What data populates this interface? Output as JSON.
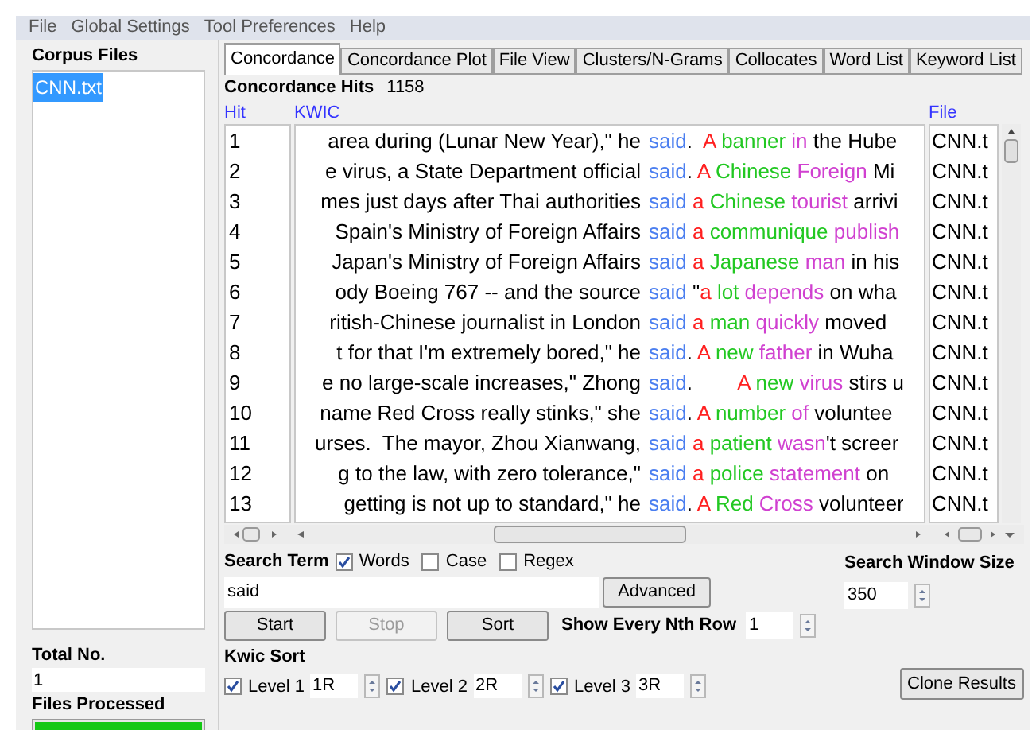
{
  "menu": [
    "File",
    "Global Settings",
    "Tool Preferences",
    "Help"
  ],
  "corpus": {
    "title": "Corpus Files",
    "files": [
      {
        "name": "CNN.txt",
        "selected": true
      }
    ],
    "total_label": "Total No.",
    "total": "1",
    "processed_label": "Files Processed",
    "progress": {
      "level": 1
    }
  },
  "tabs": [
    {
      "label": "Concordance",
      "selected": true
    },
    {
      "label": "Concordance Plot",
      "selected": false
    },
    {
      "label": "File View",
      "selected": false
    },
    {
      "label": "Clusters/N-Grams",
      "selected": false
    },
    {
      "label": "Collocates",
      "selected": false
    },
    {
      "label": "Word List",
      "selected": false
    },
    {
      "label": "Keyword List",
      "selected": false
    }
  ],
  "hits_label": "Concordance Hits",
  "hits": "1158",
  "columns": [
    "Hit",
    "KWIC",
    "File"
  ],
  "rows": [
    {
      "hit": "1",
      "left": "area during (Lunar New Year),\" he",
      "keyword": "said",
      "right": [
        {
          "text": ".  "
        },
        {
          "text": "A ",
          "color": "#ff2020"
        },
        {
          "text": "banner ",
          "color": "#22c822"
        },
        {
          "text": "in ",
          "color": "#d040d0"
        },
        {
          "text": "the Hube"
        }
      ],
      "file": "CNN.t"
    },
    {
      "hit": "2",
      "left": "e virus, a State Department official",
      "keyword": "said",
      "right": [
        {
          "text": ". "
        },
        {
          "text": "A ",
          "color": "#ff2020"
        },
        {
          "text": "Chinese ",
          "color": "#22c822"
        },
        {
          "text": "Foreign ",
          "color": "#d040d0"
        },
        {
          "text": "Mi"
        }
      ],
      "file": "CNN.t"
    },
    {
      "hit": "3",
      "left": "mes just days after Thai authorities",
      "keyword": "said",
      "right": [
        {
          "text": " a ",
          "color": "#ff2020"
        },
        {
          "text": "Chinese ",
          "color": "#22c822"
        },
        {
          "text": "tourist ",
          "color": "#d040d0"
        },
        {
          "text": "arrivi"
        }
      ],
      "file": "CNN.t"
    },
    {
      "hit": "4",
      "left": "Spain's Ministry of Foreign Affairs",
      "keyword": "said",
      "right": [
        {
          "text": " a ",
          "color": "#ff2020"
        },
        {
          "text": "communique ",
          "color": "#22c822"
        },
        {
          "text": "publish",
          "color": "#d040d0"
        }
      ],
      "file": "CNN.t"
    },
    {
      "hit": "5",
      "left": "Japan's Ministry of Foreign Affairs",
      "keyword": "said",
      "right": [
        {
          "text": " a ",
          "color": "#ff2020"
        },
        {
          "text": "Japanese ",
          "color": "#22c822"
        },
        {
          "text": "man ",
          "color": "#d040d0"
        },
        {
          "text": "in his"
        }
      ],
      "file": "CNN.t"
    },
    {
      "hit": "6",
      "left": "ody Boeing 767 -- and the source",
      "keyword": "said",
      "right": [
        {
          "text": " \""
        },
        {
          "text": "a ",
          "color": "#ff2020"
        },
        {
          "text": "lot ",
          "color": "#22c822"
        },
        {
          "text": "depends ",
          "color": "#d040d0"
        },
        {
          "text": "on wha"
        }
      ],
      "file": "CNN.t"
    },
    {
      "hit": "7",
      "left": "ritish-Chinese journalist in London",
      "keyword": "said",
      "right": [
        {
          "text": " a ",
          "color": "#ff2020"
        },
        {
          "text": "man ",
          "color": "#22c822"
        },
        {
          "text": "quickly ",
          "color": "#d040d0"
        },
        {
          "text": "moved"
        }
      ],
      "file": "CNN.t"
    },
    {
      "hit": "8",
      "left": "t for that I'm extremely bored,\" he",
      "keyword": "said",
      "right": [
        {
          "text": ". "
        },
        {
          "text": "A ",
          "color": "#ff2020"
        },
        {
          "text": "new ",
          "color": "#22c822"
        },
        {
          "text": "father ",
          "color": "#d040d0"
        },
        {
          "text": "in Wuha"
        }
      ],
      "file": "CNN.t"
    },
    {
      "hit": "9",
      "left": "e no large-scale increases,\" Zhong",
      "keyword": "said",
      "right": [
        {
          "text": ".        "
        },
        {
          "text": "A ",
          "color": "#ff2020"
        },
        {
          "text": "new ",
          "color": "#22c822"
        },
        {
          "text": "virus ",
          "color": "#d040d0"
        },
        {
          "text": "stirs u"
        }
      ],
      "file": "CNN.t"
    },
    {
      "hit": "10",
      "left": "name Red Cross really stinks,\" she",
      "keyword": "said",
      "right": [
        {
          "text": ". "
        },
        {
          "text": "A ",
          "color": "#ff2020"
        },
        {
          "text": "number ",
          "color": "#22c822"
        },
        {
          "text": "of ",
          "color": "#d040d0"
        },
        {
          "text": "voluntee"
        }
      ],
      "file": "CNN.t"
    },
    {
      "hit": "11",
      "left": "urses.  The mayor, Zhou Xianwang,",
      "keyword": "said",
      "right": [
        {
          "text": " a ",
          "color": "#ff2020"
        },
        {
          "text": "patient ",
          "color": "#22c822"
        },
        {
          "text": "wasn",
          "color": "#d040d0"
        },
        {
          "text": "'t screer"
        }
      ],
      "file": "CNN.t"
    },
    {
      "hit": "12",
      "left": "g to the law, with zero tolerance,\"",
      "keyword": "said",
      "right": [
        {
          "text": " a ",
          "color": "#ff2020"
        },
        {
          "text": "police ",
          "color": "#22c822"
        },
        {
          "text": "statement ",
          "color": "#d040d0"
        },
        {
          "text": "on"
        }
      ],
      "file": "CNN.t"
    },
    {
      "hit": "13",
      "left": "getting is not up to standard,\" he",
      "keyword": "said",
      "right": [
        {
          "text": ". "
        },
        {
          "text": "A ",
          "color": "#ff2020"
        },
        {
          "text": "Red ",
          "color": "#22c822"
        },
        {
          "text": "Cross ",
          "color": "#d040d0"
        },
        {
          "text": "volunteer"
        }
      ],
      "file": "CNN.t"
    }
  ],
  "search": {
    "label": "Search Term",
    "options": [
      {
        "label": "Words",
        "checked": true
      },
      {
        "label": "Case",
        "checked": false
      },
      {
        "label": "Regex",
        "checked": false
      }
    ],
    "value": "said",
    "advanced": "Advanced",
    "window_label": "Search Window Size",
    "window": "350"
  },
  "buttons": [
    {
      "label": "Start",
      "disabled": false
    },
    {
      "label": "Stop",
      "disabled": true
    },
    {
      "label": "Sort",
      "disabled": false
    }
  ],
  "nth": {
    "label": "Show Every Nth Row",
    "value": "1"
  },
  "sort": {
    "label": "Kwic Sort",
    "levels": [
      {
        "label": "Level 1",
        "checked": true,
        "value": "1R"
      },
      {
        "label": "Level 2",
        "checked": true,
        "value": "2R"
      },
      {
        "label": "Level 3",
        "checked": true,
        "value": "3R"
      }
    ]
  },
  "clone": "Clone Results"
}
